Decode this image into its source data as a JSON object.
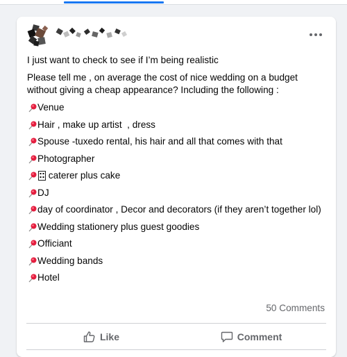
{
  "post": {
    "author": {
      "name_redacted": true
    },
    "more_icon": "more-horizontal-icon",
    "intro": "I just want to check to see if I’m being realistic",
    "question": "Please tell me , on average the cost of nice wedding on a budget without giving a cheap appearance? Including the following :",
    "items": [
      "Venue",
      "Hair , make up artist  , dress",
      "Spouse -tuxedo rental, his hair and all that comes with that",
      "Photographer",
      "⁣ caterer plus cake",
      "DJ",
      "day of coordinator , Decor and decorators (if they aren’t together lol)",
      "Wedding stationery plus guest goodies",
      "Officiant",
      "Wedding bands",
      "Hotel"
    ],
    "comments_count": "50 Comments"
  },
  "actions": {
    "like_label": "Like",
    "comment_label": "Comment"
  },
  "colors": {
    "background": "#f0f2f5",
    "card": "#ffffff",
    "text": "#050505",
    "secondary_text": "#65676b",
    "pin": "#e41e3f",
    "accent": "#1877f2"
  }
}
